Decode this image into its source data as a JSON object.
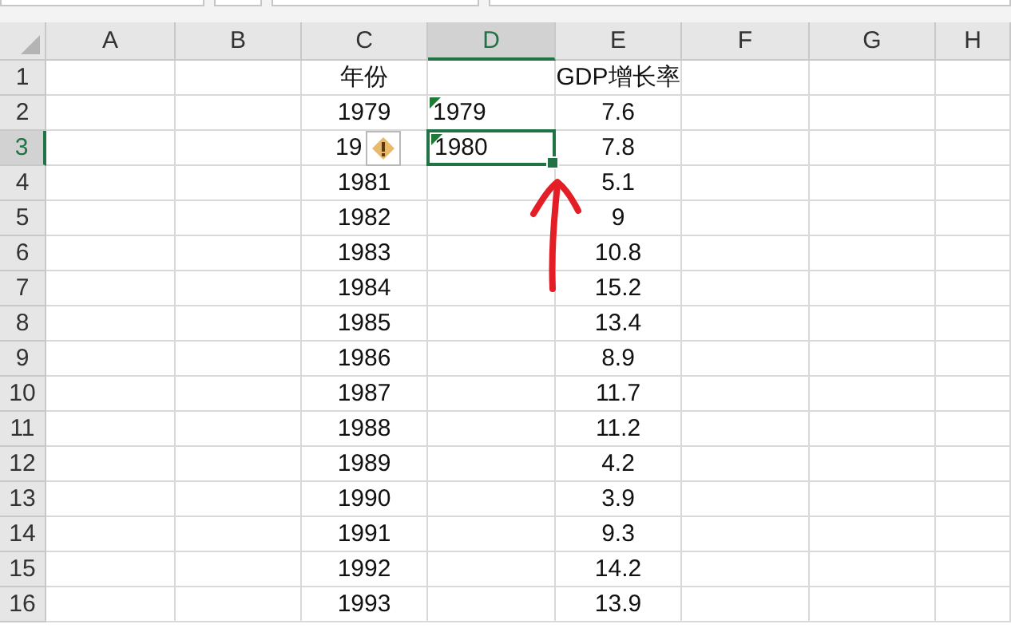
{
  "columns": [
    {
      "label": "A",
      "selected": false
    },
    {
      "label": "B",
      "selected": false
    },
    {
      "label": "C",
      "selected": false
    },
    {
      "label": "D",
      "selected": true
    },
    {
      "label": "E",
      "selected": false
    },
    {
      "label": "F",
      "selected": false
    },
    {
      "label": "G",
      "selected": false
    },
    {
      "label": "H",
      "selected": false
    }
  ],
  "rows": [
    {
      "number": "1",
      "selected": false,
      "column_c": {
        "text": "年份"
      },
      "column_e": {
        "text": "GDP增长率"
      }
    },
    {
      "number": "2",
      "selected": false,
      "column_c": {
        "text": "1979"
      },
      "column_d": {
        "text": "1979",
        "error_marker": true,
        "selected": false
      },
      "column_e": {
        "text": "7.6"
      }
    },
    {
      "number": "3",
      "selected": true,
      "column_c": {
        "text": "19",
        "warning_button": true
      },
      "column_d": {
        "text": "1980",
        "error_marker": true,
        "selected": true
      },
      "column_e": {
        "text": "7.8"
      }
    },
    {
      "number": "4",
      "selected": false,
      "column_c": {
        "text": "1981"
      },
      "column_e": {
        "text": "5.1"
      }
    },
    {
      "number": "5",
      "selected": false,
      "column_c": {
        "text": "1982"
      },
      "column_e": {
        "text": "9"
      }
    },
    {
      "number": "6",
      "selected": false,
      "column_c": {
        "text": "1983"
      },
      "column_e": {
        "text": "10.8"
      }
    },
    {
      "number": "7",
      "selected": false,
      "column_c": {
        "text": "1984"
      },
      "column_e": {
        "text": "15.2"
      }
    },
    {
      "number": "8",
      "selected": false,
      "column_c": {
        "text": "1985"
      },
      "column_e": {
        "text": "13.4"
      }
    },
    {
      "number": "9",
      "selected": false,
      "column_c": {
        "text": "1986"
      },
      "column_e": {
        "text": "8.9"
      }
    },
    {
      "number": "10",
      "selected": false,
      "column_c": {
        "text": "1987"
      },
      "column_e": {
        "text": "11.7"
      }
    },
    {
      "number": "11",
      "selected": false,
      "column_c": {
        "text": "1988"
      },
      "column_e": {
        "text": "11.2"
      }
    },
    {
      "number": "12",
      "selected": false,
      "column_c": {
        "text": "1989"
      },
      "column_e": {
        "text": "4.2"
      }
    },
    {
      "number": "13",
      "selected": false,
      "column_c": {
        "text": "1990"
      },
      "column_e": {
        "text": "3.9"
      }
    },
    {
      "number": "14",
      "selected": false,
      "column_c": {
        "text": "1991"
      },
      "column_e": {
        "text": "9.3"
      }
    },
    {
      "number": "15",
      "selected": false,
      "column_c": {
        "text": "1992"
      },
      "column_e": {
        "text": "14.2"
      }
    },
    {
      "number": "16",
      "selected": false,
      "column_c": {
        "text": "1993"
      },
      "column_e": {
        "text": "13.9"
      }
    }
  ],
  "annotations": [
    {
      "kind": "arrow"
    }
  ]
}
